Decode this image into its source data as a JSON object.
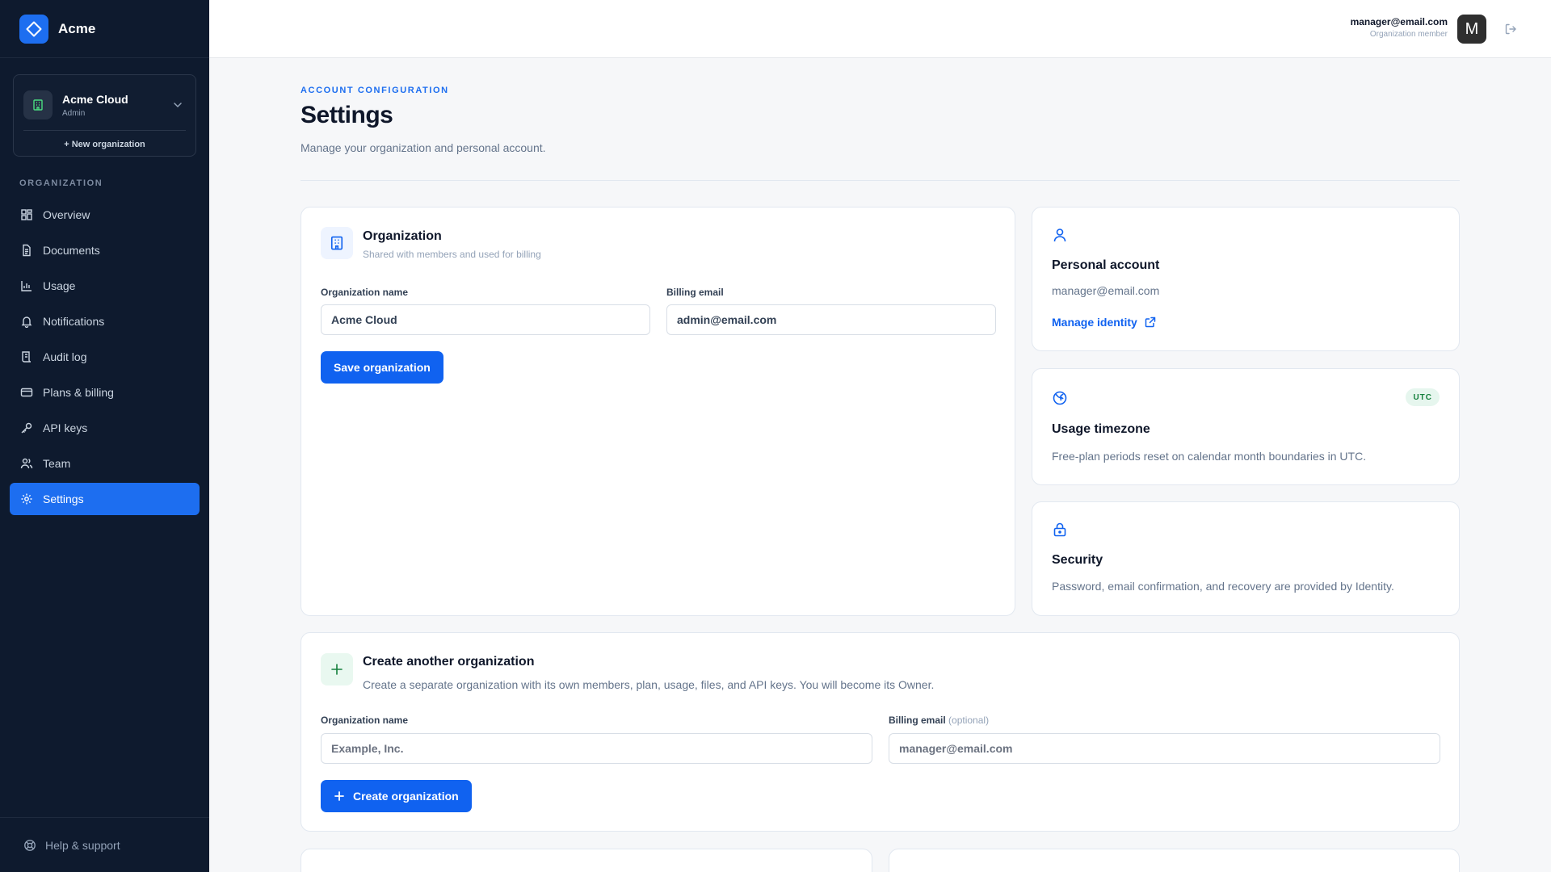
{
  "brand": {
    "name": "Acme"
  },
  "org_switcher": {
    "name": "Acme Cloud",
    "role": "Admin",
    "new_label": "+ New organization"
  },
  "nav": {
    "section": "ORGANIZATION",
    "items": [
      {
        "label": "Overview",
        "icon": "grid-icon"
      },
      {
        "label": "Documents",
        "icon": "document-icon"
      },
      {
        "label": "Usage",
        "icon": "bar-chart-icon"
      },
      {
        "label": "Notifications",
        "icon": "bell-icon"
      },
      {
        "label": "Audit log",
        "icon": "scroll-icon"
      },
      {
        "label": "Plans & billing",
        "icon": "credit-card-icon"
      },
      {
        "label": "API keys",
        "icon": "key-icon"
      },
      {
        "label": "Team",
        "icon": "users-icon"
      },
      {
        "label": "Settings",
        "icon": "gear-icon",
        "active": true
      }
    ],
    "help": "Help & support"
  },
  "topbar": {
    "email": "manager@email.com",
    "role": "Organization member",
    "avatar_letter": "M"
  },
  "page": {
    "eyebrow": "ACCOUNT CONFIGURATION",
    "title": "Settings",
    "subtitle": "Manage your organization and personal account."
  },
  "org_card": {
    "title": "Organization",
    "subtitle": "Shared with members and used for billing",
    "name_label": "Organization name",
    "name_value": "Acme Cloud",
    "email_label": "Billing email",
    "email_value": "admin@email.com",
    "save_label": "Save organization"
  },
  "personal": {
    "title": "Personal account",
    "email": "manager@email.com",
    "link": "Manage identity"
  },
  "timezone": {
    "badge": "UTC",
    "title": "Usage timezone",
    "text": "Free-plan periods reset on calendar month boundaries in UTC."
  },
  "security": {
    "title": "Security",
    "text": "Password, email confirmation, and recovery are provided by Identity."
  },
  "create": {
    "title": "Create another organization",
    "subtitle": "Create a separate organization with its own members, plan, usage, files, and API keys. You will become its Owner.",
    "name_label": "Organization name",
    "name_placeholder": "Example, Inc.",
    "email_label": "Billing email",
    "email_optional": "(optional)",
    "email_placeholder": "manager@email.com",
    "button": "Create organization"
  },
  "colors": {
    "accent": "#1062f0",
    "sidebar": "#0e1a2e",
    "success": "#15803d"
  }
}
